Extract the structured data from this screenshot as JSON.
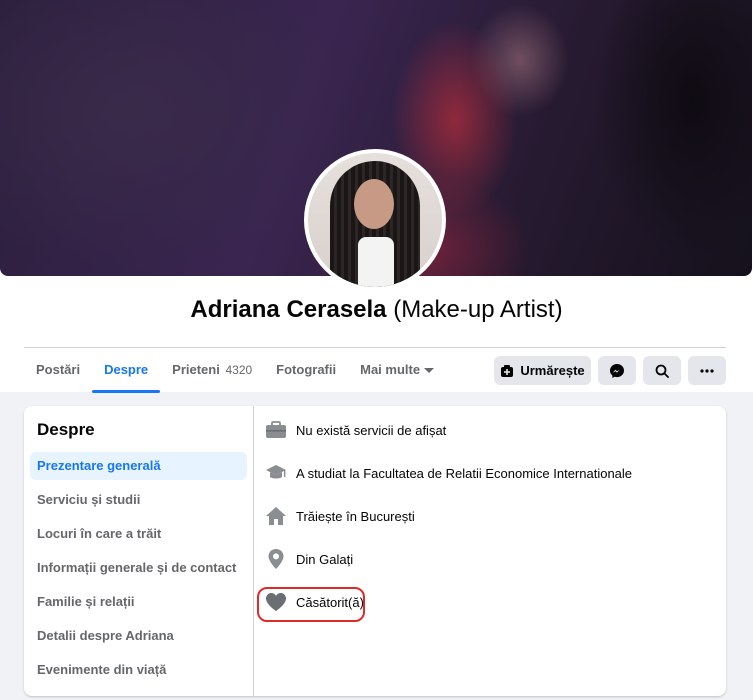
{
  "profile": {
    "name": "Adriana Cerasela",
    "alternate_name": "(Make-up Artist)"
  },
  "tabs": [
    {
      "label": "Postări"
    },
    {
      "label": "Despre",
      "active": true
    },
    {
      "label": "Prieteni",
      "count": "4320"
    },
    {
      "label": "Fotografii"
    },
    {
      "label": "Mai multe"
    }
  ],
  "actions": {
    "follow_label": "Urmărește"
  },
  "about": {
    "heading": "Despre",
    "menu": [
      {
        "label": "Prezentare generală",
        "active": true
      },
      {
        "label": "Serviciu și studii"
      },
      {
        "label": "Locuri în care a trăit"
      },
      {
        "label": "Informații generale și de contact"
      },
      {
        "label": "Familie și relații"
      },
      {
        "label": "Detalii despre Adriana"
      },
      {
        "label": "Evenimente din viață"
      }
    ],
    "overview": [
      {
        "icon": "briefcase-icon",
        "text": "Nu există servicii de afișat"
      },
      {
        "icon": "graduation-cap-icon",
        "text": "A studiat la Facultatea de Relatii Economice Internationale"
      },
      {
        "icon": "home-icon",
        "text": "Trăiește în București"
      },
      {
        "icon": "location-pin-icon",
        "text": "Din Galați"
      },
      {
        "icon": "heart-icon",
        "text": "Căsătorit(ă)"
      }
    ]
  },
  "colors": {
    "accent": "#1877f2",
    "highlight_annotation": "#e02a2a"
  }
}
